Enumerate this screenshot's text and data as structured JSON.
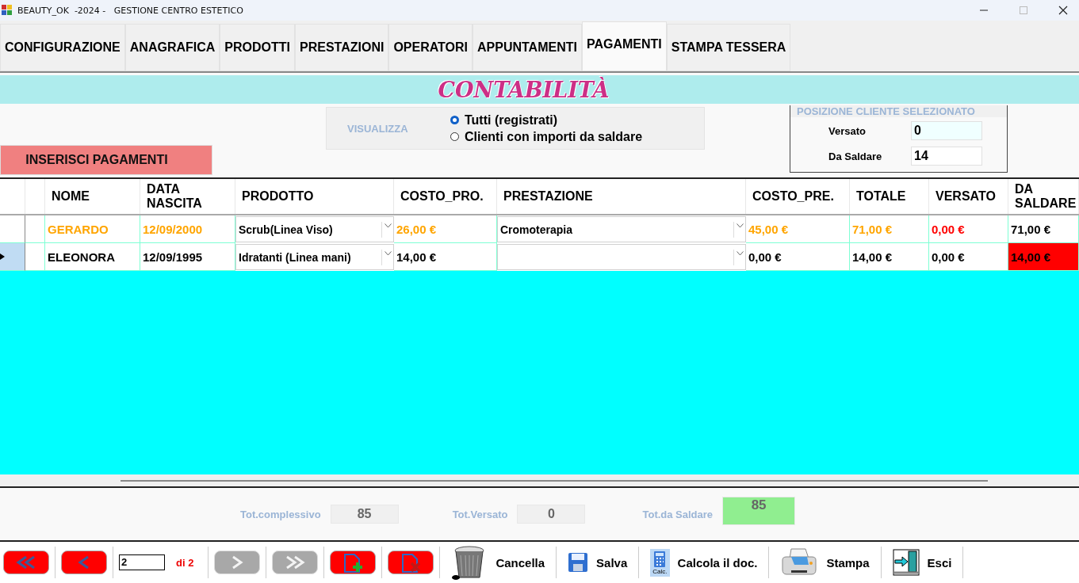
{
  "window": {
    "title": "BEAUTY_OK  -2024 -   GESTIONE CENTRO ESTETICO"
  },
  "tabs": [
    {
      "label": "CONFIGURAZIONE",
      "selected": false
    },
    {
      "label": "ANAGRAFICA",
      "selected": false
    },
    {
      "label": "PRODOTTI",
      "selected": false
    },
    {
      "label": "PRESTAZIONI",
      "selected": false
    },
    {
      "label": "OPERATORI",
      "selected": false
    },
    {
      "label": "APPUNTAMENTI",
      "selected": false
    },
    {
      "label": "PAGAMENTI",
      "selected": true
    },
    {
      "label": "STAMPA TESSERA",
      "selected": false
    }
  ],
  "banner": {
    "title": "CONTABILITÀ"
  },
  "insert_button": "INSERISCI PAGAMENTI",
  "filter": {
    "label": "VISUALIZZA",
    "options": [
      {
        "label": "Tutti (registrati)",
        "selected": true
      },
      {
        "label": "Clienti con importi da saldare",
        "selected": false
      }
    ]
  },
  "client_position": {
    "title": "POSIZIONE CLIENTE SELEZIONATO",
    "fields": [
      {
        "label": "Versato",
        "value": "0"
      },
      {
        "label": "Da Saldare",
        "value": "14"
      }
    ]
  },
  "table": {
    "columns": [
      "NOME",
      "DATA NASCITA",
      "PRODOTTO",
      "COSTO_PRO.",
      "PRESTAZIONE",
      "COSTO_PRE.",
      "TOTALE",
      "VERSATO",
      "DA SALDARE"
    ],
    "rows": [
      {
        "current": false,
        "cells": [
          {
            "kind": "text",
            "value": "GERARDO",
            "color": "#ffa500",
            "alert": false
          },
          {
            "kind": "text",
            "value": "12/09/2000",
            "color": "#ffa500",
            "alert": false
          },
          {
            "kind": "dropdown",
            "value": "Scrub(Linea Viso)"
          },
          {
            "kind": "text",
            "value": "26,00 €",
            "color": "#ffa500",
            "alert": false
          },
          {
            "kind": "dropdown",
            "value": "Cromoterapia"
          },
          {
            "kind": "text",
            "value": "45,00 €",
            "color": "#ffa500",
            "alert": false
          },
          {
            "kind": "text",
            "value": "71,00 €",
            "color": "#ffa500",
            "alert": false
          },
          {
            "kind": "text",
            "value": "0,00 €",
            "color": "#ff0000",
            "alert": false
          },
          {
            "kind": "text",
            "value": "71,00 €",
            "color": "#000000",
            "alert": false
          }
        ]
      },
      {
        "current": true,
        "cells": [
          {
            "kind": "text",
            "value": "ELEONORA",
            "color": "#000000",
            "alert": false
          },
          {
            "kind": "text",
            "value": "12/09/1995",
            "color": "#000000",
            "alert": false
          },
          {
            "kind": "dropdown",
            "value": "Idratanti (Linea mani)"
          },
          {
            "kind": "text",
            "value": "14,00 €",
            "color": "#000000",
            "alert": false
          },
          {
            "kind": "dropdown"
          },
          {
            "kind": "text",
            "value": "0,00 €",
            "color": "#000000",
            "alert": false
          },
          {
            "kind": "text",
            "value": "14,00 €",
            "color": "#000000",
            "alert": false
          },
          {
            "kind": "text",
            "value": "0,00 €",
            "color": "#000000",
            "alert": false
          },
          {
            "kind": "text",
            "value": "14,00 €",
            "color": "#000000",
            "alert": true
          }
        ]
      }
    ]
  },
  "totals": [
    {
      "label": "Tot.complessivo",
      "value": "85",
      "kind": "plain"
    },
    {
      "label": "Tot.Versato",
      "value": "0",
      "kind": "plain"
    },
    {
      "label": "Tot.da Saldare",
      "value": "85",
      "kind": "highlight"
    }
  ],
  "toolbar": {
    "nav": [
      {
        "kind": "first",
        "disabled": false
      },
      {
        "kind": "prev",
        "disabled": false
      }
    ],
    "page": {
      "value": "2",
      "total": "di 2"
    },
    "nav2": [
      {
        "kind": "next",
        "disabled": true
      },
      {
        "kind": "last",
        "disabled": true
      },
      {
        "kind": "add",
        "disabled": false
      },
      {
        "kind": "remove",
        "disabled": false
      }
    ],
    "actions": [
      {
        "kind": "trash",
        "label": "Cancella"
      },
      {
        "kind": "save",
        "label": "Salva"
      },
      {
        "kind": "calc",
        "label": "Calcola il doc.",
        "icon_label": "Calc."
      },
      {
        "kind": "print",
        "label": "Stampa"
      },
      {
        "kind": "exit",
        "label": "Esci"
      }
    ]
  }
}
